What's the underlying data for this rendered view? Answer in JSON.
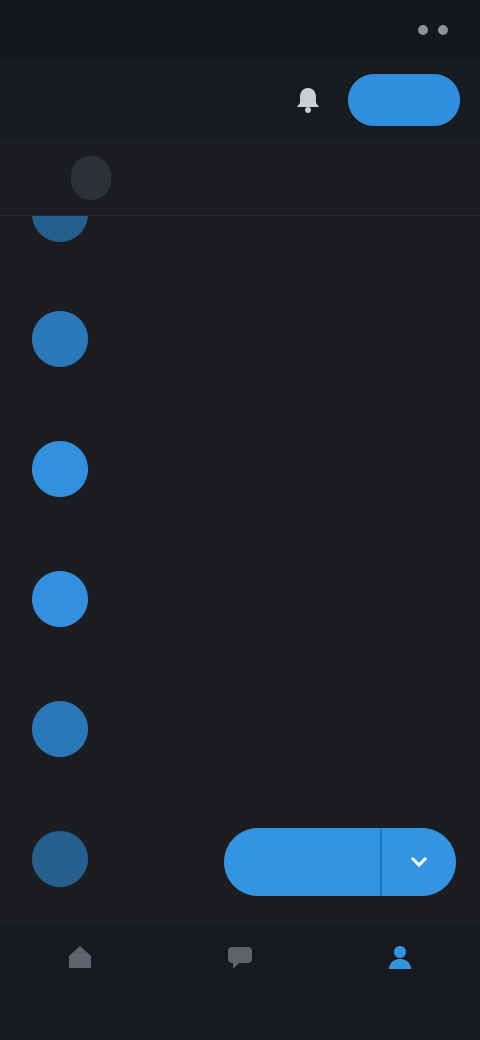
{
  "status_bar": {
    "time": "",
    "indicators": ""
  },
  "header": {
    "title": "",
    "bell_icon": "bell-icon",
    "primary_button": ""
  },
  "tabs": [
    {
      "label": "",
      "active": true
    },
    {
      "label": "",
      "active": false
    },
    {
      "label": "",
      "active": false
    }
  ],
  "list": {
    "items": [
      {
        "name": "",
        "lines": [
          ""
        ]
      },
      {
        "name": "",
        "lines": [
          "",
          ""
        ]
      },
      {
        "name": "",
        "lines": [
          "",
          ""
        ]
      },
      {
        "name": "",
        "lines": [
          "",
          ""
        ]
      },
      {
        "name": "",
        "lines": [
          "",
          ""
        ]
      },
      {
        "name": "",
        "lines": [
          ""
        ]
      }
    ],
    "action_button": {
      "label": "",
      "more_icon": "chevron-down-icon"
    }
  },
  "bottom_nav": [
    {
      "label": "",
      "icon": "home-icon",
      "active": false
    },
    {
      "label": "",
      "icon": "chat-icon",
      "active": false
    },
    {
      "label": "",
      "icon": "person-icon",
      "active": true
    }
  ],
  "colors": {
    "accent": "#3394e2",
    "background": "#1b1d21",
    "header": "#171a1f"
  }
}
